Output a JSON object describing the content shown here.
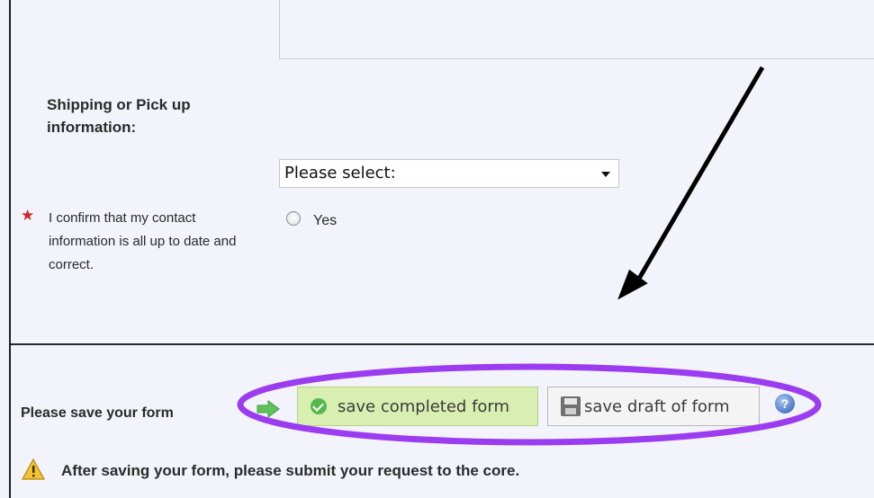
{
  "shipping": {
    "heading": "Shipping or Pick up information:",
    "select_value": "Please select:"
  },
  "confirmation": {
    "label": "I confirm that my contact information is all up to date and correct.",
    "option_yes": "Yes",
    "required_marker": "★"
  },
  "save": {
    "label": "Please save your form",
    "complete_button": "save completed form",
    "draft_button": "save draft of form",
    "help_icon": "?"
  },
  "notice": {
    "text": "After saving your form, please submit your request to the core."
  },
  "icons": {
    "arrow": "arrow-right-icon",
    "check": "check-circle-icon",
    "draft": "floppy-disk-icon",
    "help": "help-icon",
    "warning": "warning-icon"
  },
  "colors": {
    "panel_bg": "#f2f3fb",
    "complete_button_bg": "#d9efb2",
    "annotation_purple": "#9b3cf0",
    "required_red": "#d32626"
  }
}
